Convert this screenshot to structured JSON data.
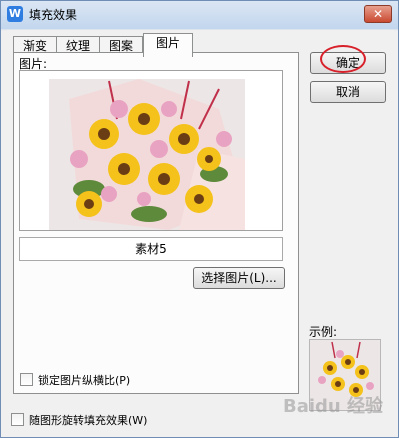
{
  "window": {
    "title": "填充效果",
    "app_icon_letter": "W",
    "close_glyph": "✕"
  },
  "tabs": [
    {
      "label": "渐变"
    },
    {
      "label": "纹理"
    },
    {
      "label": "图案"
    },
    {
      "label": "图片"
    }
  ],
  "picture_panel": {
    "picture_label": "图片:",
    "image_name": "素材5",
    "select_button": "选择图片(L)...",
    "lock_aspect_label": "锁定图片纵横比(P)",
    "lock_aspect_checked": false
  },
  "footer": {
    "rotate_label": "随图形旋转填充效果(W)",
    "rotate_checked": false
  },
  "actions": {
    "ok": "确定",
    "cancel": "取消"
  },
  "sample": {
    "label": "示例:"
  },
  "watermark": "Baidu 经验",
  "colors": {
    "accent": "#2f7de1",
    "annotation": "#d8202a",
    "title_gradient": "#c2d6ed"
  }
}
